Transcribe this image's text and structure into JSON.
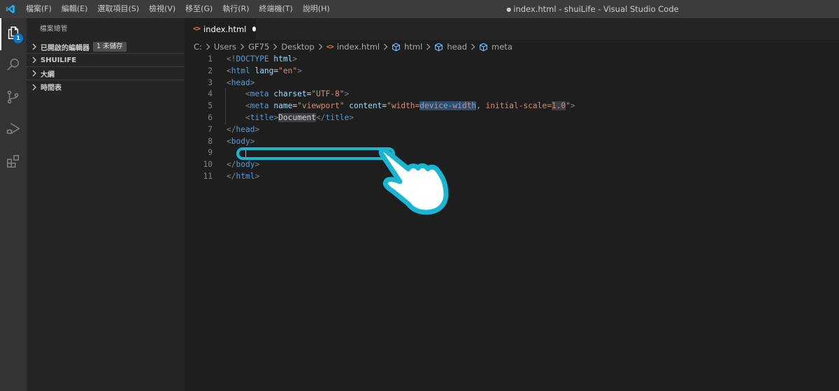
{
  "titlebar": {
    "menu": [
      "檔案(F)",
      "編輯(E)",
      "選取項目(S)",
      "檢視(V)",
      "移至(G)",
      "執行(R)",
      "終端機(T)",
      "說明(H)"
    ],
    "dirty_marker": "●",
    "window_title": "index.html - shuiLife - Visual Studio Code",
    "logo_icon": "vscode-logo-icon"
  },
  "activitybar": {
    "items": [
      {
        "name": "explorer",
        "icon": "files-icon",
        "badge": "1",
        "active": true
      },
      {
        "name": "search",
        "icon": "search-icon"
      },
      {
        "name": "source-control",
        "icon": "source-control-icon"
      },
      {
        "name": "run-debug",
        "icon": "run-debug-icon"
      },
      {
        "name": "extensions",
        "icon": "extensions-icon"
      }
    ]
  },
  "sidebar": {
    "title": "檔案總管",
    "sections": [
      {
        "label": "已開啟的編輯器",
        "badge": "1 未儲存"
      },
      {
        "label": "SHUILIFE"
      },
      {
        "label": "大綱"
      },
      {
        "label": "時間表"
      }
    ]
  },
  "editor": {
    "tab": {
      "label": "index.html",
      "icon": "html-file-icon",
      "unsaved": true
    },
    "breadcrumb": [
      "C:",
      "Users",
      "GF75",
      "Desktop",
      "index.html",
      "html",
      "head",
      "meta"
    ],
    "lines": [
      {
        "n": "1",
        "text": "<!DOCTYPE html>"
      },
      {
        "n": "2",
        "text": "<html lang=\"en\">"
      },
      {
        "n": "3",
        "text": "<head>"
      },
      {
        "n": "4",
        "text": "    <meta charset=\"UTF-8\">"
      },
      {
        "n": "5",
        "text": "    <meta name=\"viewport\" content=\"width=device-width, initial-scale=1.0\">"
      },
      {
        "n": "6",
        "text": "    <title>Document</title>"
      },
      {
        "n": "7",
        "text": "</head>"
      },
      {
        "n": "8",
        "text": "<body>"
      },
      {
        "n": "9",
        "text": "    "
      },
      {
        "n": "10",
        "text": "</body>"
      },
      {
        "n": "11",
        "text": "</html>"
      }
    ],
    "tokens": {
      "l1": {
        "a": "<!",
        "b": "DOCTYPE",
        "c": " ",
        "d": "html",
        "e": ">"
      },
      "l2": {
        "a": "<",
        "b": "html",
        "c": " ",
        "d": "lang",
        "e": "=",
        "f": "\"en\"",
        "g": ">"
      },
      "l3": {
        "a": "<",
        "b": "head",
        "c": ">"
      },
      "l4": {
        "ind": "    ",
        "a": "<",
        "b": "meta",
        "c": " ",
        "d": "charset",
        "e": "=",
        "f": "\"UTF-8\"",
        "g": ">"
      },
      "l5": {
        "ind": "    ",
        "a": "<",
        "b": "meta",
        "c": " ",
        "d": "name",
        "e": "=",
        "f": "\"viewport\"",
        "g": " ",
        "h": "content",
        "i": "=",
        "j": "\"width=",
        "k": "device-width",
        "l": ", initial-scale=",
        "m": "1.0",
        "n": "\"",
        "o": ">"
      },
      "l6": {
        "ind": "    ",
        "a": "<",
        "b": "title",
        "c": ">",
        "d": "Document",
        "e": "</",
        "f": "title",
        "g": ">"
      },
      "l7": {
        "a": "</",
        "b": "head",
        "c": ">"
      },
      "l8": {
        "a": "<",
        "b": "body",
        "c": ">"
      },
      "l9": {
        "ind": "    "
      },
      "l10": {
        "a": "</",
        "b": "body",
        "c": ">"
      },
      "l11": {
        "a": "</",
        "b": "html",
        "c": ">"
      }
    },
    "annotation": {
      "description": "highlight callout on line 9 with pointing hand",
      "color": "#1ab5d1"
    }
  },
  "colors": {
    "accent": "#007acc",
    "callout": "#1ab5d1",
    "tag": "#569cd6",
    "attr": "#9cdcfe",
    "string": "#ce9178",
    "html_icon": "#e37933"
  }
}
